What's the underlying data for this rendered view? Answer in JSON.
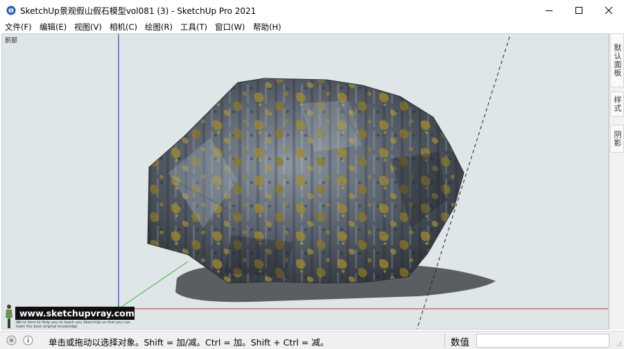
{
  "window": {
    "title": "SketchUp景观假山假石模型vol081 (3) - SketchUp Pro 2021",
    "app_icon": "sketchup-logo-icon"
  },
  "menu": {
    "items": [
      {
        "label": "文件(F)"
      },
      {
        "label": "编辑(E)"
      },
      {
        "label": "视图(V)"
      },
      {
        "label": "相机(C)"
      },
      {
        "label": "绘图(R)"
      },
      {
        "label": "工具(T)"
      },
      {
        "label": "窗口(W)"
      },
      {
        "label": "帮助(H)"
      }
    ]
  },
  "viewport": {
    "scene_label": "前部",
    "background": "#dfe6e8",
    "axis_colors": {
      "blue": "#1a1ad6",
      "green": "#2fb82f",
      "red": "#c43030"
    }
  },
  "tray": {
    "tabs": [
      {
        "label": "默认面板"
      },
      {
        "label": "样式"
      },
      {
        "label": "阴影"
      }
    ]
  },
  "watermark": {
    "url": "www.sketchupvray.com",
    "subtext": "We're here to Help you to teach you SketchUp so that you can learn the best original knowledge"
  },
  "status": {
    "hint": "单击或拖动以选择对象。Shift = 加/减。Ctrl = 加。Shift + Ctrl = 减。",
    "measurements_label": "数值",
    "measurements_value": ""
  }
}
